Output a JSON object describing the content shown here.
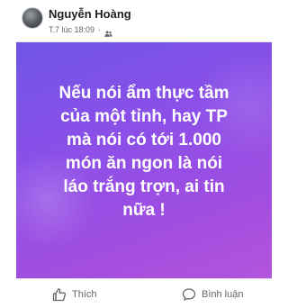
{
  "post": {
    "author": "Nguyễn Hoàng",
    "timestamp": "T.7 lúc 18:09",
    "separator": "·",
    "audience_icon": "friends-icon",
    "text_line_1": "Nếu nói ẩm thực tầm",
    "text_line_2": "của một tỉnh, hay TP",
    "text_line_3": "mà nói có tới 1.000",
    "text_line_4": "món ăn ngon là nói",
    "text_line_5": "láo trắng trợn, ai tin",
    "text_line_6": "nữa !",
    "background_colors": [
      "#6f55e6",
      "#8c4fe8",
      "#b354dc"
    ],
    "text_color": "#ffffff"
  },
  "actions": {
    "like_label": "Thích",
    "like_icon": "thumbs-up-icon",
    "comment_label": "Bình luận",
    "comment_icon": "comment-icon"
  }
}
